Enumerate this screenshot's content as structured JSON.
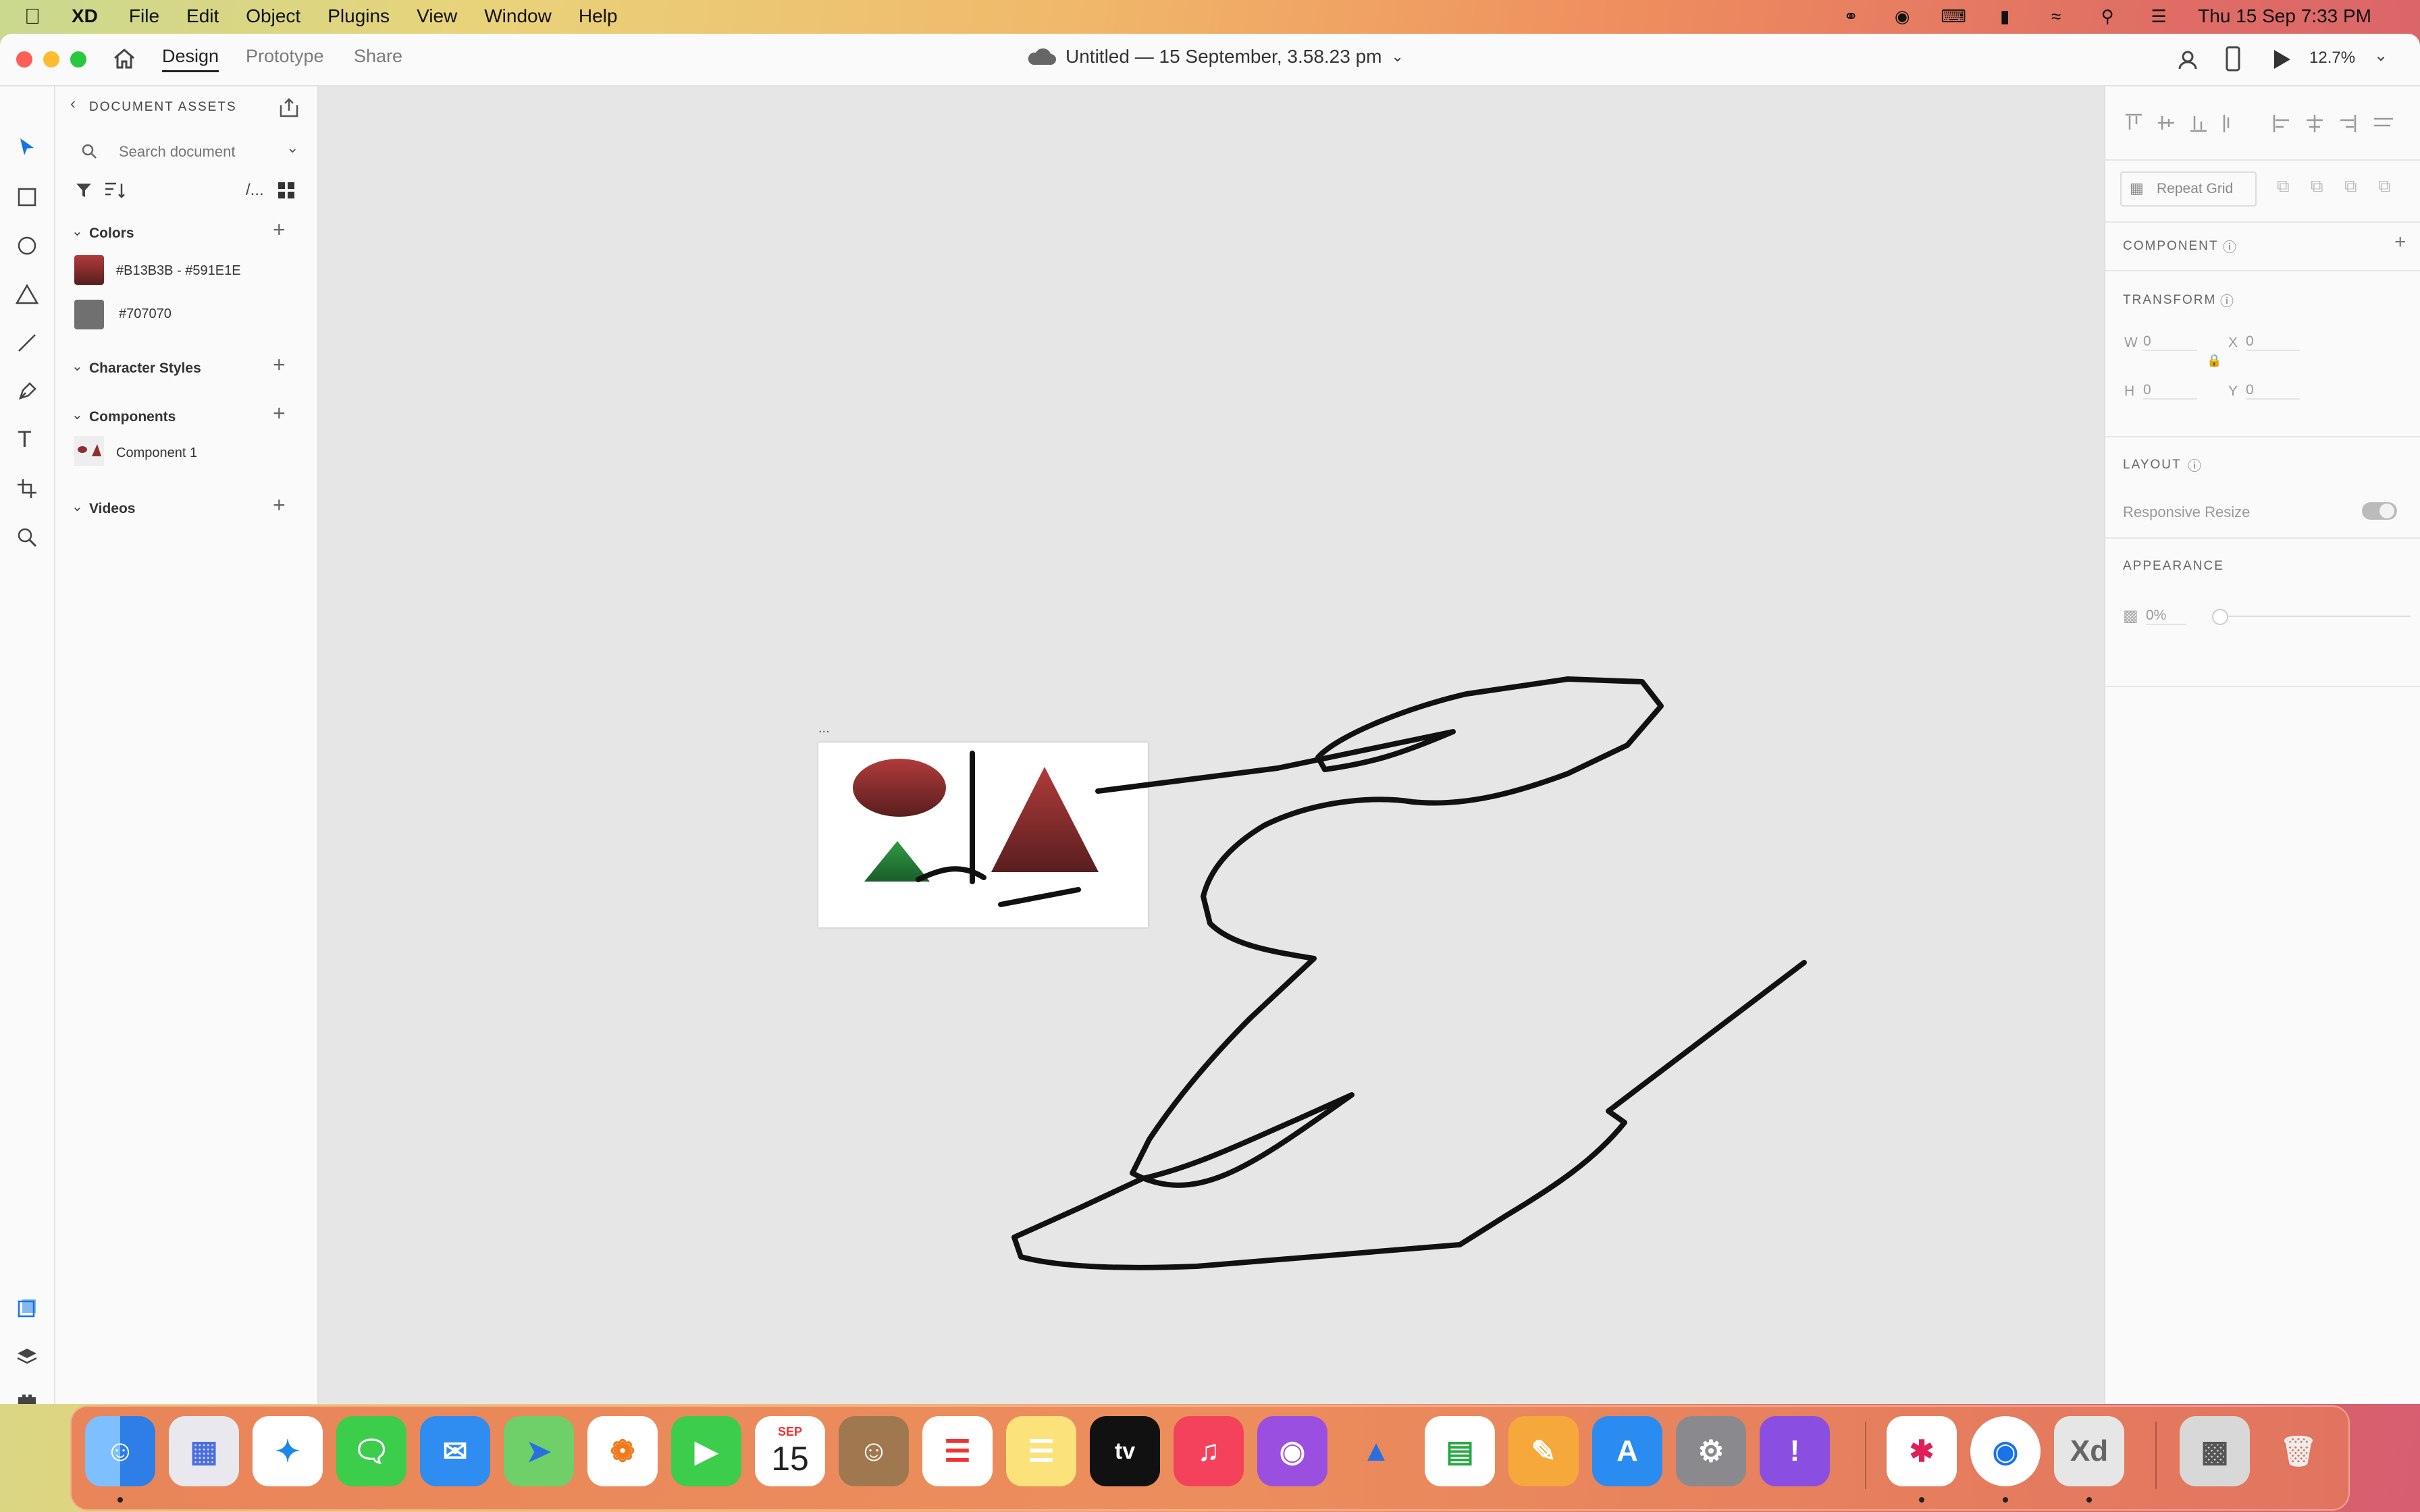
{
  "menubar": {
    "apple": "",
    "app_name": "XD",
    "items": [
      "File",
      "Edit",
      "Object",
      "Plugins",
      "View",
      "Window",
      "Help"
    ],
    "datetime": "Thu 15 Sep  7:33 PM"
  },
  "titlebar": {
    "tabs": [
      "Design",
      "Prototype",
      "Share"
    ],
    "active_tab": "Design",
    "document_title": "Untitled — 15 September, 3.58.23 pm",
    "zoom": "12.7%"
  },
  "assets": {
    "header": "DOCUMENT ASSETS",
    "search_placeholder": "Search document",
    "view_toggle_label": "/...",
    "sections": {
      "colors": "Colors",
      "character_styles": "Character Styles",
      "components": "Components",
      "videos": "Videos"
    },
    "colors": [
      {
        "label": "#B13B3B - #591E1E",
        "from": "#B13B3B",
        "to": "#591E1E"
      },
      {
        "label": "#707070",
        "from": "#707070",
        "to": "#707070"
      }
    ],
    "components": [
      {
        "label": "Component 1"
      }
    ]
  },
  "properties": {
    "repeat_grid": "Repeat Grid",
    "component": "COMPONENT",
    "transform": "TRANSFORM",
    "w_label": "W",
    "w_value": "0",
    "x_label": "X",
    "x_value": "0",
    "h_label": "H",
    "h_value": "0",
    "y_label": "Y",
    "y_value": "0",
    "layout": "LAYOUT",
    "responsive_resize": "Responsive Resize",
    "appearance": "APPEARANCE",
    "opacity": "0%"
  },
  "canvas": {
    "artboard_label": "..."
  },
  "dock": {
    "calendar_month": "SEP",
    "calendar_day": "15",
    "appletv_label": "tv",
    "xd_label": "Xd"
  },
  "colors": {
    "accent": "#1473e6",
    "swatch_red_from": "#B13B3B",
    "swatch_red_to": "#591E1E",
    "swatch_gray": "#707070",
    "triangle_green": "#2e8b3e"
  }
}
